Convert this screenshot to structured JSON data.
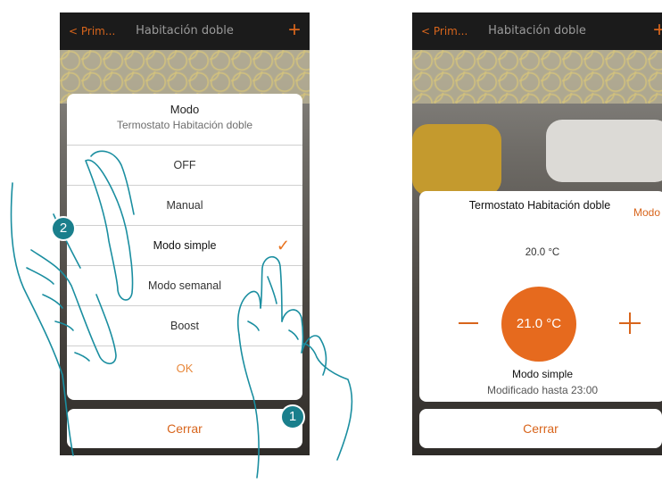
{
  "left_screen": {
    "header": {
      "back_label": "< Prim...",
      "title": "Habitación doble",
      "add_icon": "+"
    },
    "modal": {
      "title": "Modo",
      "subtitle": "Termostato Habitación doble",
      "options": [
        "OFF",
        "Manual",
        "Modo simple",
        "Modo semanal",
        "Boost"
      ],
      "selected_option": "Modo simple",
      "ok_label": "OK"
    },
    "close_label": "Cerrar"
  },
  "right_screen": {
    "header": {
      "back_label": "< Prim...",
      "title": "Habitación doble",
      "add_icon": "+"
    },
    "card": {
      "title": "Termostato Habitación doble",
      "mode_link": "Modo",
      "setpoint": "20.0 °C",
      "temperature": "21.0 °C",
      "mode_name": "Modo simple",
      "until": "Modificado hasta 23:00"
    },
    "close_label": "Cerrar"
  },
  "annotations": {
    "step_1": "1",
    "step_2": "2"
  },
  "colors": {
    "accent": "#e66a1e",
    "badge": "#1a7f8c",
    "line": "#1a8ea0"
  },
  "icons": [
    "back-icon",
    "plus-icon",
    "check-icon",
    "minus-icon",
    "hand-icon"
  ]
}
